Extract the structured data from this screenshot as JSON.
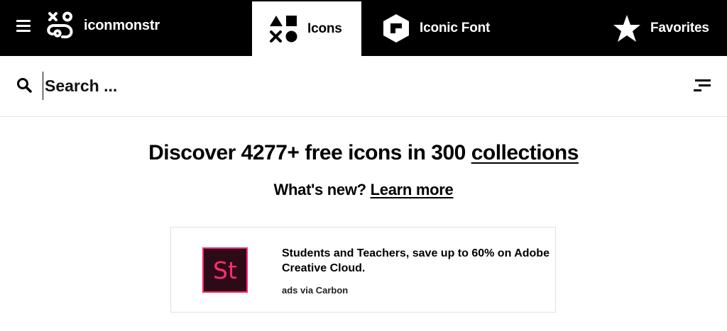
{
  "nav": {
    "brand": "iconmonstr",
    "tabs": [
      {
        "label": "Icons",
        "icon": "shapes-icon",
        "active": true
      },
      {
        "label": "Iconic Font",
        "icon": "font-icon",
        "active": false
      },
      {
        "label": "Favorites",
        "icon": "star-icon",
        "active": false
      }
    ]
  },
  "search": {
    "placeholder": "Search ...",
    "value": ""
  },
  "hero": {
    "headline_prefix": "Discover 4277+ free icons in 300 ",
    "headline_link": "collections",
    "subline_prefix": "What's new? ",
    "subline_link": "Learn more"
  },
  "ad": {
    "logo_text": "St",
    "text": "Students and Teachers, save up to 60% on Adobe Creative Cloud.",
    "via": "ads via Carbon",
    "colors": {
      "logo_bg": "#2d0a17",
      "logo_accent": "#ff2a68"
    }
  },
  "colors": {
    "nav_bg": "#000000",
    "active_tab_bg": "#ffffff",
    "page_bg": "#ffffff"
  }
}
